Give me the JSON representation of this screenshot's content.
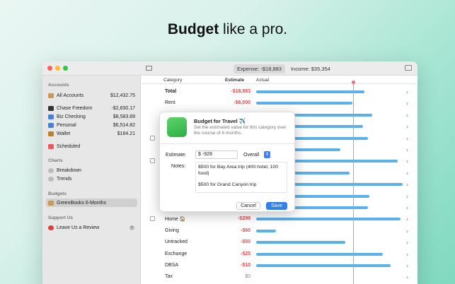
{
  "headline": {
    "bold": "Budget",
    "rest": " like a pro."
  },
  "toolbar": {
    "expense": "Expense: -$18,883",
    "income": "Income: $35,354"
  },
  "sidebar": {
    "accounts_label": "Accounts",
    "accounts": [
      {
        "name": "All Accounts",
        "value": "$12,432.75",
        "icon": "tray-icon",
        "color": "#c79a5c"
      },
      {
        "name": "Chase Freedom",
        "value": "-$2,830.17",
        "icon": "card-icon",
        "color": "#333333"
      },
      {
        "name": "Biz Checking",
        "value": "$8,583.89",
        "icon": "pen-icon",
        "color": "#4a7fd1"
      },
      {
        "name": "Personal",
        "value": "$6,514.82",
        "icon": "pen-icon",
        "color": "#4a7fd1"
      },
      {
        "name": "Wallet",
        "value": "$164.21",
        "icon": "wallet-icon",
        "color": "#b9823b"
      }
    ],
    "scheduled": "Scheduled",
    "charts_label": "Charts",
    "charts": [
      "Breakdown",
      "Trends"
    ],
    "budgets_label": "Budgets",
    "budget_item": "GreenBooks 6-Months",
    "support_label": "Support Us",
    "support_item": "Leave Us a Review",
    "support_badge": "x"
  },
  "columns": {
    "category": "Category",
    "estimate": "Estimate",
    "actual": "Actual"
  },
  "rows": [
    {
      "cat": "Total",
      "est": "-$18,883",
      "bar": 0.72,
      "bold": true
    },
    {
      "cat": "Rent",
      "est": "-$6,000",
      "bar": 0.64
    },
    {
      "cat": "",
      "est": "",
      "bar": 0.77
    },
    {
      "cat": "",
      "est": "",
      "bar": 0.71
    },
    {
      "cat": "",
      "est": "",
      "bar": 0.74
    },
    {
      "cat": "",
      "est": "",
      "bar": 0.56
    },
    {
      "cat": "",
      "est": "",
      "bar": 0.94
    },
    {
      "cat": "",
      "est": "",
      "bar": 0.62
    },
    {
      "cat": "",
      "est": "",
      "bar": 0.97
    },
    {
      "cat": "",
      "est": "",
      "bar": 0.75
    },
    {
      "cat": "",
      "est": "",
      "bar": 0.74
    },
    {
      "cat": "Home 🏠",
      "est": "-$299",
      "bar": 0.96
    },
    {
      "cat": "Giving",
      "est": "-$60",
      "bar": 0.13
    },
    {
      "cat": "Untracked",
      "est": "-$50",
      "bar": 0.59
    },
    {
      "cat": "Exchange",
      "est": "-$25",
      "bar": 0.84
    },
    {
      "cat": "DBSA",
      "est": "-$10",
      "bar": 0.89
    },
    {
      "cat": "Tax",
      "est": "$0",
      "bar": 0,
      "zero": true
    }
  ],
  "popover": {
    "title": "Budget for Travel ✈️",
    "subtitle": "Set the estimated value for this category over the course of 6 months.",
    "estimate_label": "Estimate:",
    "estimate_value": "$  -928",
    "period": "Overall",
    "notes_label": "Notes:",
    "notes_1": "$500 for Bay Area trip (400 hotel, 100 food)",
    "notes_2": "$500 for Grand Canyon trip",
    "cancel": "Cancel",
    "save": "Save"
  }
}
